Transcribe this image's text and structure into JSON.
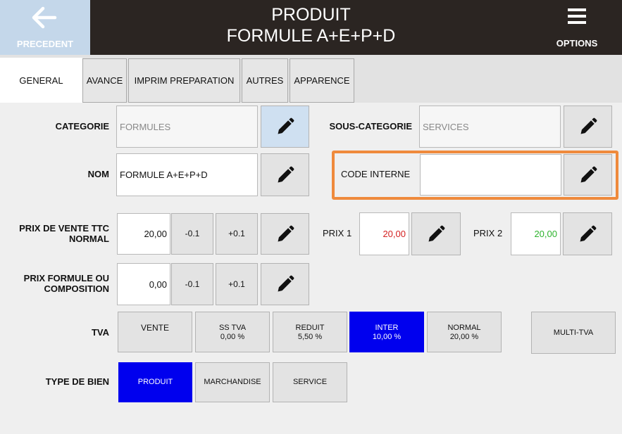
{
  "header": {
    "back_label": "PRECEDENT",
    "title_line1": "PRODUIT",
    "title_line2": "FORMULE A+E+P+D",
    "options_label": "OPTIONS"
  },
  "tabs": [
    {
      "label": "GENERAL",
      "active": true
    },
    {
      "label": "AVANCE"
    },
    {
      "label": "IMPRIM PREPARATION"
    },
    {
      "label": "AUTRES"
    },
    {
      "label": "APPARENCE"
    }
  ],
  "categorie": {
    "label": "CATEGORIE",
    "value": "FORMULES"
  },
  "sous_categorie": {
    "label": "SOUS-CATEGORIE",
    "value": "SERVICES"
  },
  "nom": {
    "label": "NOM",
    "value": "FORMULE A+E+P+D"
  },
  "code_interne": {
    "label": "CODE INTERNE",
    "value": ""
  },
  "prix_vente": {
    "label_line1": "PRIX DE VENTE TTC",
    "label_line2": "NORMAL",
    "value": "20,00",
    "minus": "-0.1",
    "plus": "+0.1"
  },
  "prix1": {
    "label": "PRIX 1",
    "value": "20,00",
    "color": "#d42020"
  },
  "prix2": {
    "label": "PRIX 2",
    "value": "20,00",
    "color": "#2db32d"
  },
  "prix_formule": {
    "label_line1": "PRIX FORMULE OU",
    "label_line2": "COMPOSITION",
    "value": "0,00",
    "minus": "-0.1",
    "plus": "+0.1"
  },
  "tva": {
    "label": "TVA",
    "options": [
      {
        "name": "VENTE",
        "rate": ""
      },
      {
        "name": "SS TVA",
        "rate": "0,00 %"
      },
      {
        "name": "REDUIT",
        "rate": "5,50 %"
      },
      {
        "name": "INTER",
        "rate": "10,00 %"
      },
      {
        "name": "NORMAL",
        "rate": "20,00 %"
      }
    ],
    "selected": "INTER",
    "multi_label": "MULTI-TVA"
  },
  "type_bien": {
    "label": "TYPE DE BIEN",
    "options": [
      "PRODUIT",
      "MARCHANDISE",
      "SERVICE"
    ],
    "selected": "PRODUIT"
  },
  "colors": {
    "header_bg": "#2b2522",
    "back_bg": "#c4d7ea",
    "selected_blue": "#0000ee",
    "highlight": "#ef8a3c"
  }
}
